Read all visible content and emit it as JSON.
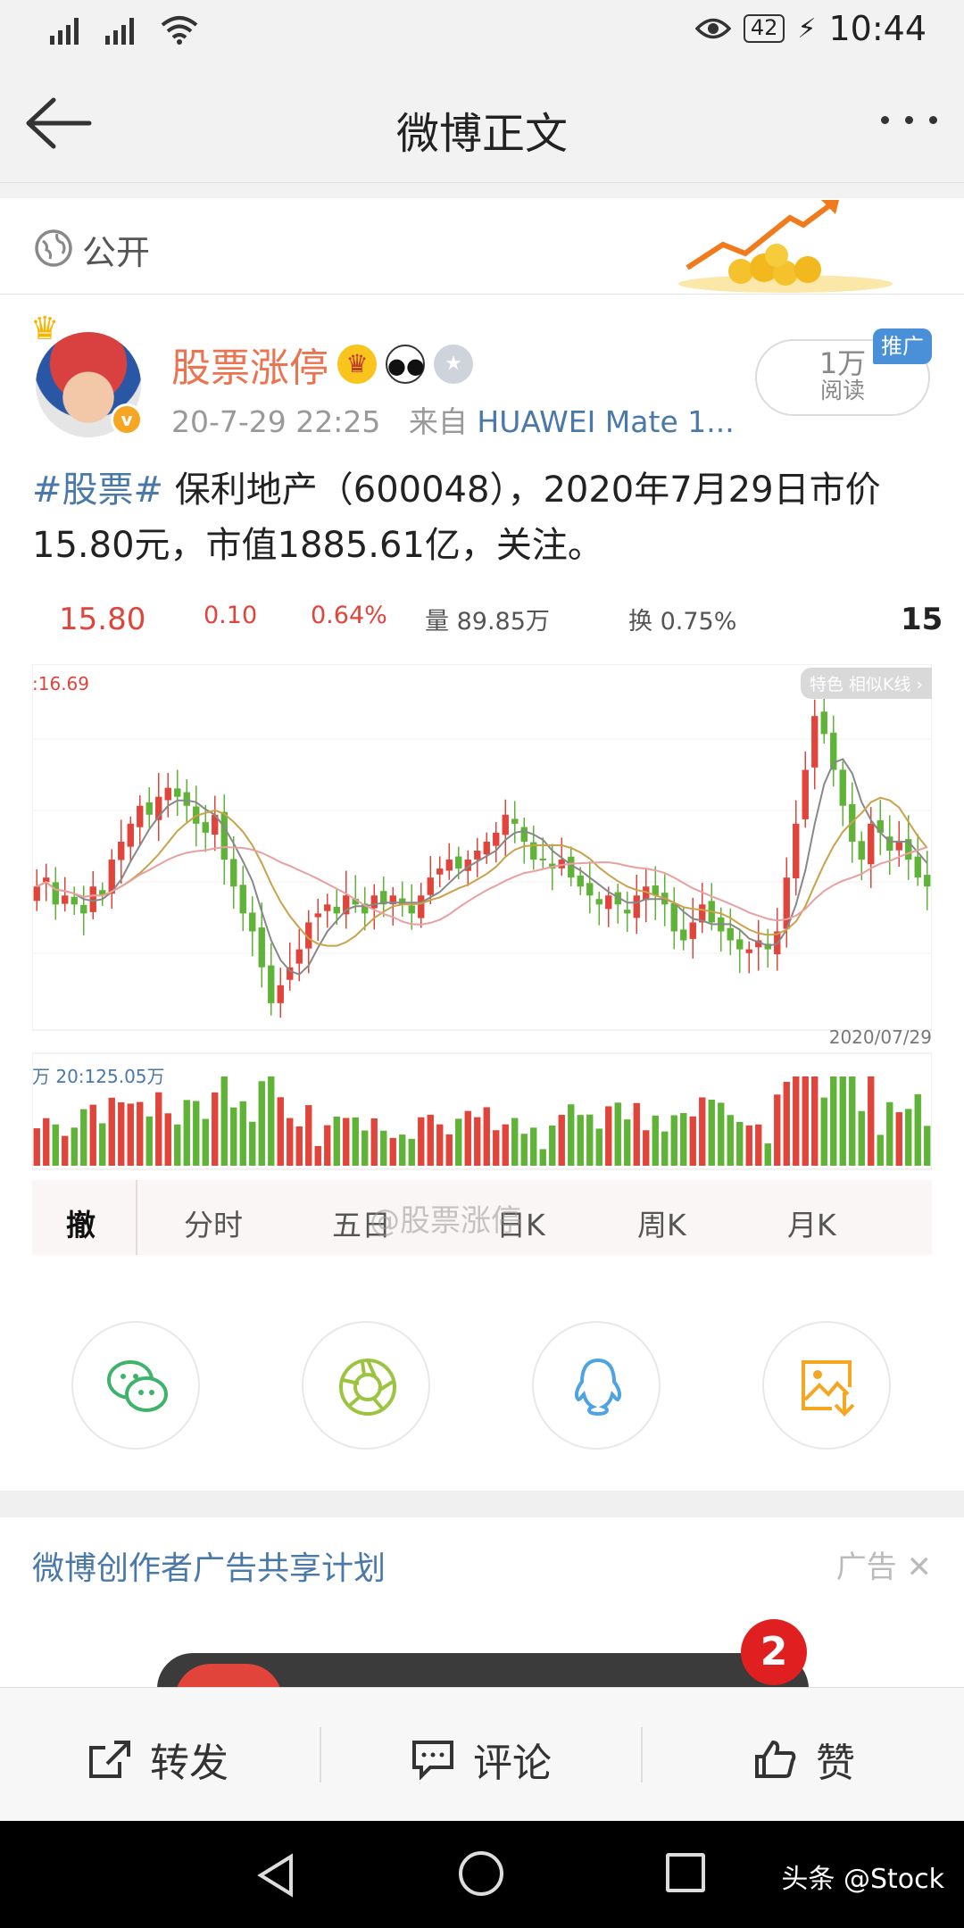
{
  "status_bar": {
    "battery": "42",
    "time": "10:44"
  },
  "header": {
    "title": "微博正文"
  },
  "visibility": {
    "label": "公开"
  },
  "post": {
    "author": "股票涨停",
    "time": "20-7-29 22:25",
    "source_prefix": "来自",
    "source": "HUAWEI Mate 1...",
    "reads_count": "1万",
    "reads_label": "阅读",
    "promo_badge": "推广",
    "hashtag": "#股票#",
    "body": " 保利地产（600048），2020年7月29日市价15.80元，市值1885.61亿，关注。"
  },
  "quote": {
    "price": "15.80",
    "change": "0.10",
    "change_pct": "0.64%",
    "volume": "量 89.85万",
    "turnover": "换 0.75%",
    "cut_value": "15"
  },
  "chart_data": {
    "type": "candlestick",
    "high_label": ":16.69",
    "feature_tag": "特色 相似K线 ›",
    "date_label": "2020/07/29",
    "volume_label": "20:125.05万",
    "volume_unit": "万",
    "closes": [
      15.55,
      15.6,
      15.45,
      15.5,
      15.45,
      15.4,
      15.55,
      15.5,
      15.7,
      15.8,
      15.9,
      16.0,
      15.95,
      16.05,
      16.1,
      16.05,
      16.0,
      15.9,
      15.85,
      15.95,
      15.7,
      15.55,
      15.4,
      15.3,
      15.1,
      14.9,
      15.0,
      15.1,
      15.2,
      15.35,
      15.4,
      15.45,
      15.4,
      15.5,
      15.45,
      15.4,
      15.5,
      15.45,
      15.5,
      15.45,
      15.4,
      15.5,
      15.6,
      15.65,
      15.7,
      15.65,
      15.7,
      15.75,
      15.8,
      15.85,
      15.95,
      15.9,
      15.8,
      15.7,
      15.7,
      15.65,
      15.7,
      15.6,
      15.55,
      15.5,
      15.45,
      15.5,
      15.45,
      15.4,
      15.5,
      15.55,
      15.5,
      15.45,
      15.3,
      15.25,
      15.35,
      15.45,
      15.35,
      15.3,
      15.25,
      15.2,
      15.2,
      15.25,
      15.2,
      15.3,
      15.6,
      15.9,
      16.2,
      16.5,
      16.4,
      16.2,
      16.0,
      15.8,
      15.7,
      15.9,
      15.85,
      15.75,
      15.8,
      15.7,
      15.6,
      15.55
    ],
    "y_range": [
      14.8,
      16.69
    ],
    "moving_averages": [
      "MA5",
      "MA10",
      "MA20"
    ],
    "tabs": [
      "撤",
      "分时",
      "五日",
      "日K",
      "周K",
      "月K"
    ],
    "watermark": "@股票涨停"
  },
  "share": [
    "wechat-icon",
    "moments-icon",
    "qq-icon",
    "save-image-icon"
  ],
  "ad": {
    "title": "微博创作者广告共享计划",
    "tag": "广告",
    "badge": "2"
  },
  "actions": {
    "repost": "转发",
    "comment": "评论",
    "like": "赞"
  },
  "nav": {
    "source_credit": "头条 @Stock"
  },
  "colors": {
    "up": "#e0443a",
    "down": "#5fb336",
    "link": "#4a78a8",
    "author": "#eb7350"
  }
}
